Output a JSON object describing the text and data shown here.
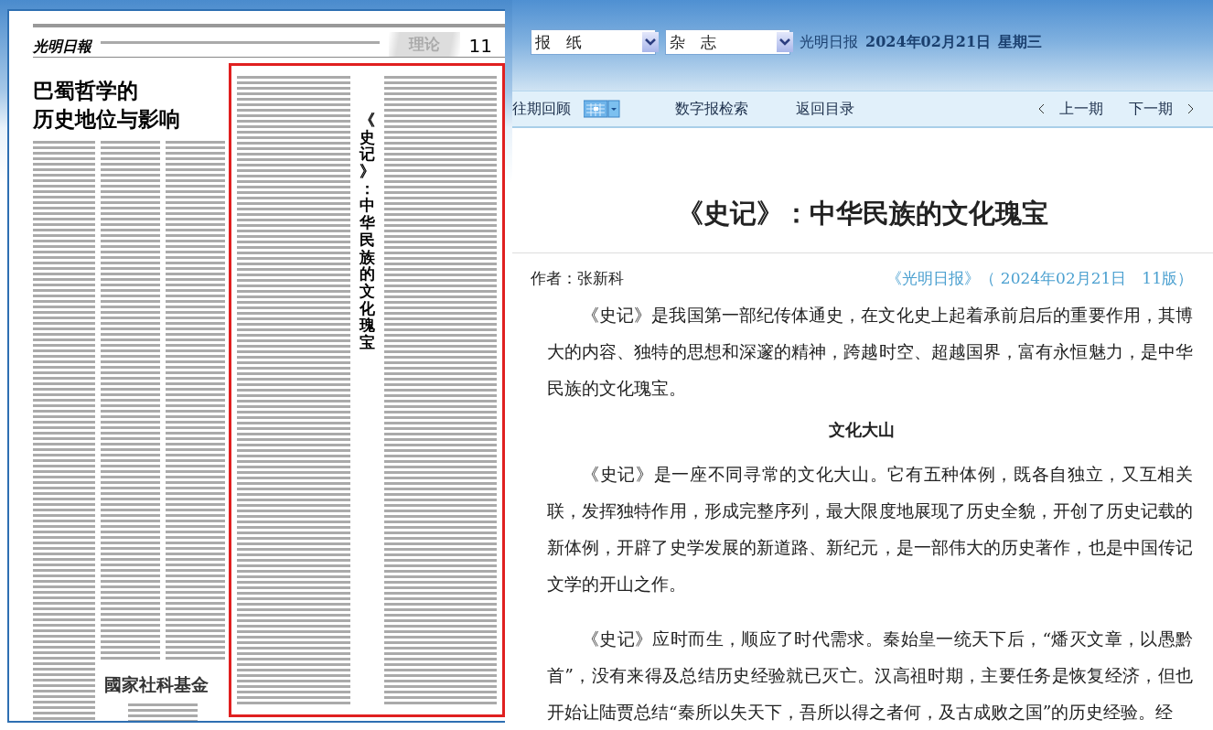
{
  "newspaper_page": {
    "masthead": "光明日報",
    "section": "理论",
    "page_number": "11",
    "headline": [
      "巴蜀哲学的",
      "历史地位与影响"
    ],
    "highlighted_article": {
      "title": "《史记》：中华民族的文化瑰宝",
      "selected": true
    },
    "logo_text": "國家社科基金"
  },
  "selectors": [
    {
      "value": "报　纸"
    },
    {
      "value": "杂　志"
    }
  ],
  "edition": {
    "paper": "光明日报",
    "date": "2024年02月21日",
    "weekday": "星期三"
  },
  "toolbar": {
    "archive": "往期回顾",
    "search": "数字报检索",
    "back": "返回目录",
    "prev": "上一期",
    "next": "下一期"
  },
  "article": {
    "title": "《史记》：中华民族的文化瑰宝",
    "author": "作者：张新科",
    "source": "《光明日报》（ 2024年02月21日　11版）",
    "blocks": [
      {
        "kind": "paragraph",
        "text": "《史记》是我国第一部纪传体通史，在文化史上起着承前启后的重要作用，其博大的内容、独特的思想和深邃的精神，跨越时空、超越国界，富有永恒魅力，是中华民族的文化瑰宝。"
      },
      {
        "kind": "heading",
        "text": "文化大山"
      },
      {
        "kind": "paragraph",
        "text": "《史记》是一座不同寻常的文化大山。它有五种体例，既各自独立，又互相关联，发挥独特作用，形成完整序列，最大限度地展现了历史全貌，开创了历史记载的新体例，开辟了史学发展的新道路、新纪元，是一部伟大的历史著作，也是中国传记文学的开山之作。"
      },
      {
        "kind": "paragraph",
        "text": "《史记》应时而生，顺应了时代需求。秦始皇一统天下后，“燔灭文章，以愚黔首”，没有来得及总结历史经验就已灭亡。汉高祖时期，主要任务是恢复经济，但也开始让陆贾总结“秦所以失天下，吾所以得之者何，及古成败之国”的历史经验。经"
      }
    ]
  }
}
